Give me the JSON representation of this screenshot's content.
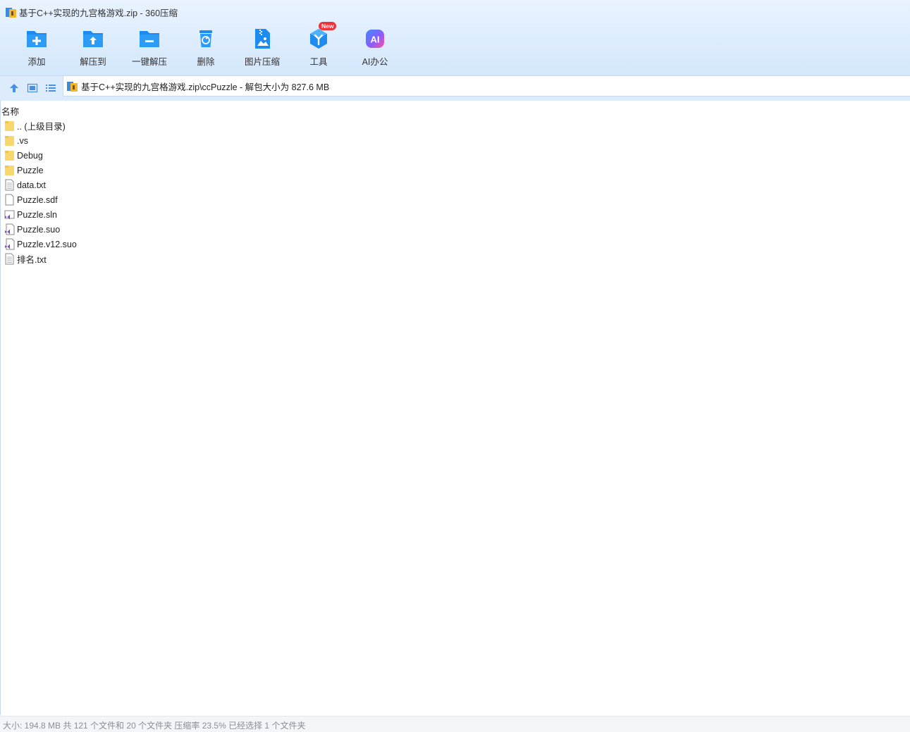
{
  "window": {
    "title": "基于C++实现的九宫格游戏.zip - 360压缩"
  },
  "toolbar": {
    "items": [
      {
        "label": "添加",
        "icon": "add-folder-icon"
      },
      {
        "label": "解压到",
        "icon": "extract-to-icon"
      },
      {
        "label": "一键解压",
        "icon": "one-click-extract-icon"
      },
      {
        "label": "删除",
        "icon": "delete-icon"
      },
      {
        "label": "图片压缩",
        "icon": "image-compress-icon"
      },
      {
        "label": "工具",
        "icon": "tools-icon",
        "badge": "New"
      },
      {
        "label": "AI办公",
        "icon": "ai-office-icon"
      }
    ]
  },
  "navbar": {
    "address": "基于C++实现的九宫格游戏.zip\\ccPuzzle - 解包大小为 827.6 MB"
  },
  "list": {
    "column_name": "名称",
    "items": [
      {
        "name": ".. (上级目录)",
        "type": "folder"
      },
      {
        "name": ".vs",
        "type": "folder"
      },
      {
        "name": "Debug",
        "type": "folder"
      },
      {
        "name": "Puzzle",
        "type": "folder"
      },
      {
        "name": "data.txt",
        "type": "text"
      },
      {
        "name": "Puzzle.sdf",
        "type": "blank"
      },
      {
        "name": "Puzzle.sln",
        "type": "vs-solution"
      },
      {
        "name": "Puzzle.suo",
        "type": "vs-file"
      },
      {
        "name": "Puzzle.v12.suo",
        "type": "vs-file"
      },
      {
        "name": "排名.txt",
        "type": "text"
      }
    ]
  },
  "status": {
    "text": "大小: 194.8 MB 共 121 个文件和 20 个文件夹 压缩率 23.5% 已经选择 1 个文件夹"
  },
  "colors": {
    "accent": "#1e8bf0",
    "folder": "#f8d86e",
    "badge": "#f0323a",
    "vs_purple": "#7c4bc2"
  }
}
